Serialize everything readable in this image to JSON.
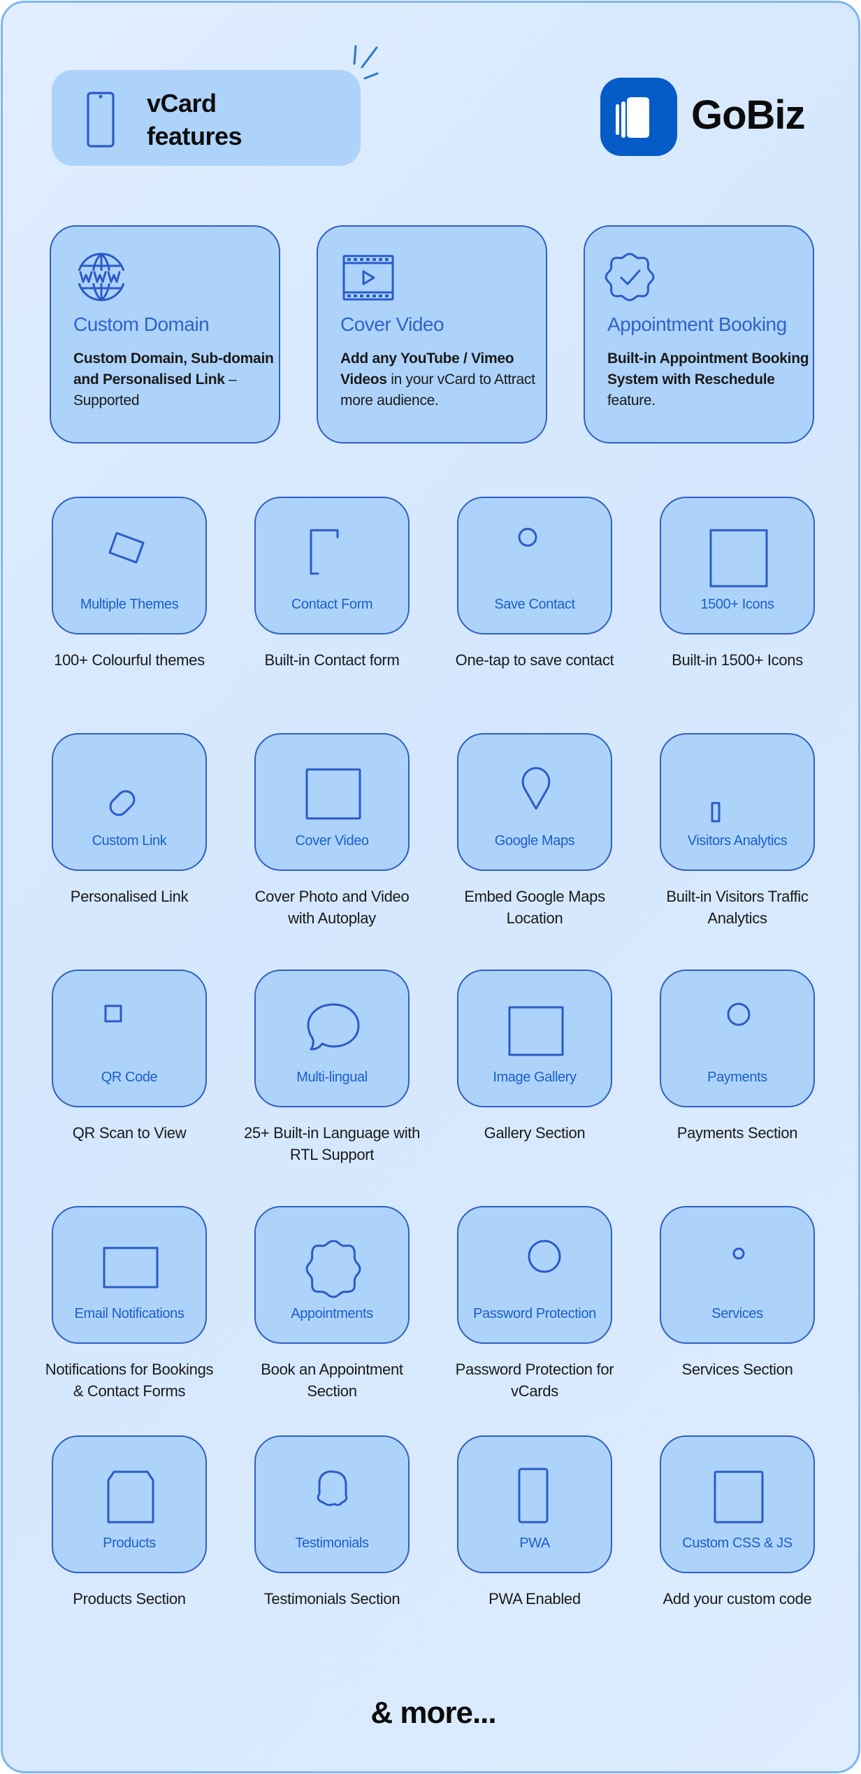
{
  "header": {
    "title_line1": "vCard",
    "title_line2": "features",
    "icon": "smartphone-icon"
  },
  "brand": {
    "name": "GoBiz",
    "logo_icon": "stacked-cards-logo-icon",
    "color": "#055cc6"
  },
  "colors": {
    "accent": "#2e63cb",
    "card_fill": "#aed3fb",
    "card_border": "#2f5fc4",
    "background": "#d9eafe",
    "frame_border": "#7fb5f5",
    "text": "#1a1a1a"
  },
  "highlights": [
    {
      "icon": "www-globe-icon",
      "title": "Custom Domain",
      "desc_bold": "Custom Domain, Sub-domain and Personalised Link",
      "desc_rest": " – Supported"
    },
    {
      "icon": "film-play-icon",
      "title": "Cover Video",
      "desc_bold": "Add any YouTube / Vimeo Videos",
      "desc_rest": " in your vCard to Attract more audience."
    },
    {
      "icon": "verified-badge-icon",
      "title": "Appointment Booking",
      "desc_bold": "Built-in Appointment Booking System with Reschedule",
      "desc_rest": " feature."
    }
  ],
  "features": [
    {
      "icon": "themes-cards-icon",
      "label": "Multiple Themes",
      "caption": "100+ Colourful themes"
    },
    {
      "icon": "contact-form-icon",
      "label": "Contact Form",
      "caption": "Built-in Contact form"
    },
    {
      "icon": "tap-finger-icon",
      "label": "Save Contact",
      "caption": "One-tap to save contact"
    },
    {
      "icon": "icon-grid-icon",
      "label": "1500+ Icons",
      "caption": "Built-in 1500+ Icons"
    },
    {
      "icon": "link-chain-icon",
      "label": "Custom Link",
      "caption": "Personalised Link"
    },
    {
      "icon": "film-play-icon",
      "label": "Cover Video",
      "caption": "Cover Photo and Video with Autoplay"
    },
    {
      "icon": "map-pin-icon",
      "label": "Google Maps",
      "caption": "Embed Google Maps Location"
    },
    {
      "icon": "analytics-chart-icon",
      "label": "Visitors Analytics",
      "caption": "Built-in Visitors Traffic Analytics"
    },
    {
      "icon": "qr-code-icon",
      "label": "QR Code",
      "caption": "QR Scan to View"
    },
    {
      "icon": "translate-bubble-icon",
      "label": "Multi-lingual",
      "caption": "25+ Built-in Language with RTL Support"
    },
    {
      "icon": "image-gallery-icon",
      "label": "Image Gallery",
      "caption": "Gallery Section"
    },
    {
      "icon": "payment-hand-icon",
      "label": "Payments",
      "caption": "Payments Section"
    },
    {
      "icon": "envelope-icon",
      "label": "Email Notifications",
      "caption": "Notifications for Bookings & Contact Forms"
    },
    {
      "icon": "verified-badge-icon",
      "label": "Appointments",
      "caption": "Book an Appointment Section"
    },
    {
      "icon": "key-icon",
      "label": "Password Protection",
      "caption": "Password Protection for vCards"
    },
    {
      "icon": "gear-hand-icon",
      "label": "Services",
      "caption": "Services Section"
    },
    {
      "icon": "package-box-icon",
      "label": "Products",
      "caption": "Products Section"
    },
    {
      "icon": "user-star-icon",
      "label": "Testimonials",
      "caption": "Testimonials Section"
    },
    {
      "icon": "phone-id-check-icon",
      "label": "PWA",
      "caption": "PWA Enabled"
    },
    {
      "icon": "js-file-icon",
      "label": "Custom CSS & JS",
      "caption": "Add your custom code"
    }
  ],
  "footer": {
    "more_text": "& more..."
  }
}
